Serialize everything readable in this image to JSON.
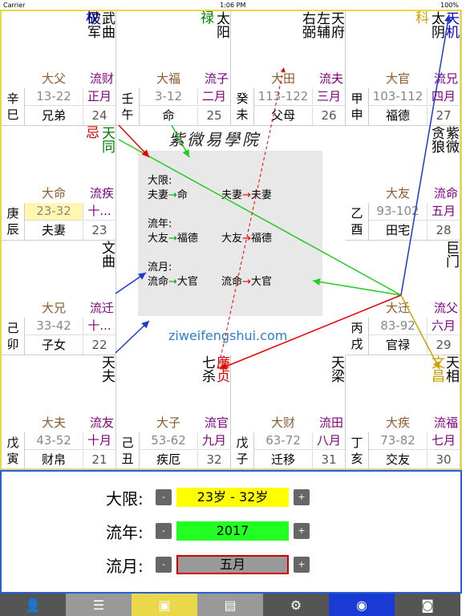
{
  "statusbar": {
    "carrier": "Carrier",
    "time": "1:06 PM",
    "battery": "100%"
  },
  "center": {
    "title": "紫微易學院",
    "daxian_label": "大限:",
    "liunian_label": "流年:",
    "liuyue_label": "流月:",
    "daxian": [
      [
        "夫妻",
        "命"
      ],
      [
        "夫妻",
        "夫妻"
      ]
    ],
    "liunian": [
      [
        "大友",
        "福德"
      ],
      [
        "大友",
        "福德"
      ]
    ],
    "liuyue": [
      [
        "流命",
        "大官"
      ],
      [
        "流命",
        "大官"
      ]
    ],
    "site": "ziweifengshui.com"
  },
  "cells": [
    {
      "stars": [
        {
          "t": "武曲",
          "c": "#000"
        },
        {
          "t": "破军",
          "c": "#000"
        }
      ],
      "hua": [
        {
          "t": "权",
          "c": "#0000cc",
          "col": 0
        }
      ],
      "da": "大父",
      "liu": "流财",
      "g": [
        "辛",
        "巳"
      ],
      "range": "13-22",
      "palace": "兄弟",
      "month": "正月",
      "num": "24",
      "hl": false
    },
    {
      "stars": [
        {
          "t": "太阳",
          "c": "#000"
        }
      ],
      "hua": [
        {
          "t": "禄",
          "c": "#008000",
          "col": 0
        }
      ],
      "da": "大福",
      "liu": "流子",
      "g": [
        "壬",
        "午"
      ],
      "range": "3-12",
      "palace": "命",
      "month": "二月",
      "num": "25",
      "hl": false
    },
    {
      "stars": [
        {
          "t": "天府",
          "c": "#000"
        },
        {
          "t": "左辅",
          "c": "#000"
        },
        {
          "t": "右弼",
          "c": "#000"
        }
      ],
      "hua": [],
      "da": "大田",
      "liu": "流夫",
      "g": [
        "癸",
        "未"
      ],
      "range": "113-122",
      "palace": "父母",
      "month": "三月",
      "num": "26",
      "hl": false
    },
    {
      "stars": [
        {
          "t": "天机",
          "c": "#0000cc"
        },
        {
          "t": "太阴",
          "c": "#000"
        }
      ],
      "hua": [
        {
          "t": "科",
          "c": "#c8a000",
          "col": 1
        }
      ],
      "da": "大官",
      "liu": "流兄",
      "g": [
        "甲",
        "申"
      ],
      "range": "103-112",
      "palace": "福德",
      "month": "四月",
      "num": "27",
      "hl": false
    },
    {
      "stars": [
        {
          "t": "天同",
          "c": "#008000"
        }
      ],
      "hua": [
        {
          "t": "忌",
          "c": "#d00",
          "col": 0
        }
      ],
      "da": "大命",
      "liu": "流疾",
      "g": [
        "庚",
        "辰"
      ],
      "range": "23-32",
      "palace": "夫妻",
      "month": "十...",
      "num": "23",
      "hl": true
    },
    {
      "stars": [
        {
          "t": "紫微",
          "c": "#000"
        },
        {
          "t": "贪狼",
          "c": "#000"
        }
      ],
      "hua": [],
      "da": "大友",
      "liu": "流命",
      "g": [
        "乙",
        "酉"
      ],
      "range": "93-102",
      "palace": "田宅",
      "month": "五月",
      "num": "28",
      "hl": false
    },
    {
      "stars": [
        {
          "t": "文曲",
          "c": "#000"
        }
      ],
      "hua": [],
      "da": "大兄",
      "liu": "流迁",
      "g": [
        "己",
        "卯"
      ],
      "range": "33-42",
      "palace": "子女",
      "month": "十...",
      "num": "22",
      "hl": false
    },
    {
      "stars": [
        {
          "t": "巨门",
          "c": "#000"
        }
      ],
      "hua": [],
      "da": "大迁",
      "liu": "流父",
      "g": [
        "丙",
        "戌"
      ],
      "range": "83-92",
      "palace": "官禄",
      "month": "六月",
      "num": "29",
      "hl": false
    },
    {
      "stars": [
        {
          "t": "天夫",
          "c": "#000"
        }
      ],
      "hua": [],
      "da": "大夫",
      "liu": "流友",
      "g": [
        "戊",
        "寅"
      ],
      "range": "43-52",
      "palace": "财帛",
      "month": "十月",
      "num": "21",
      "hl": false
    },
    {
      "stars": [
        {
          "t": "廉贞",
          "c": "#d00"
        },
        {
          "t": "七杀",
          "c": "#000"
        }
      ],
      "hua": [],
      "da": "大子",
      "liu": "流官",
      "g": [
        "己",
        "丑"
      ],
      "range": "53-62",
      "palace": "疾厄",
      "month": "九月",
      "num": "32",
      "hl": false
    },
    {
      "stars": [
        {
          "t": "天梁",
          "c": "#000"
        }
      ],
      "hua": [],
      "da": "大财",
      "liu": "流田",
      "g": [
        "戊",
        "子"
      ],
      "range": "63-72",
      "palace": "迁移",
      "month": "八月",
      "num": "31",
      "hl": false
    },
    {
      "stars": [
        {
          "t": "天相",
          "c": "#000"
        },
        {
          "t": "文昌",
          "c": "#c8a000"
        }
      ],
      "hua": [],
      "da": "大疾",
      "liu": "流福",
      "g": [
        "丁",
        "亥"
      ],
      "range": "73-82",
      "palace": "交友",
      "month": "七月",
      "num": "30",
      "hl": false
    }
  ],
  "controls": {
    "daxian": {
      "label": "大限:",
      "value": "23岁 - 32岁",
      "color": "#ffff00"
    },
    "liunian": {
      "label": "流年:",
      "value": "2017",
      "color": "#22ff22"
    },
    "liuyue": {
      "label": "流月:",
      "value": "五月",
      "color": "#999999"
    },
    "minus": "-",
    "plus": "+"
  },
  "tabs": [
    {
      "icon": "add-user-icon",
      "glyph": "👤",
      "bg": "#555"
    },
    {
      "icon": "list-icon",
      "glyph": "☰",
      "bg": "#999"
    },
    {
      "icon": "chart-doc-icon",
      "glyph": "▣",
      "bg": "#e8d84a"
    },
    {
      "icon": "edit-doc-icon",
      "glyph": "▤",
      "bg": "#999"
    },
    {
      "icon": "gear-icon",
      "glyph": "⚙",
      "bg": "#555"
    },
    {
      "icon": "eye-icon",
      "glyph": "◉",
      "bg": "#1a3ad4"
    },
    {
      "icon": "camera-icon",
      "glyph": "◙",
      "bg": "#555"
    }
  ]
}
